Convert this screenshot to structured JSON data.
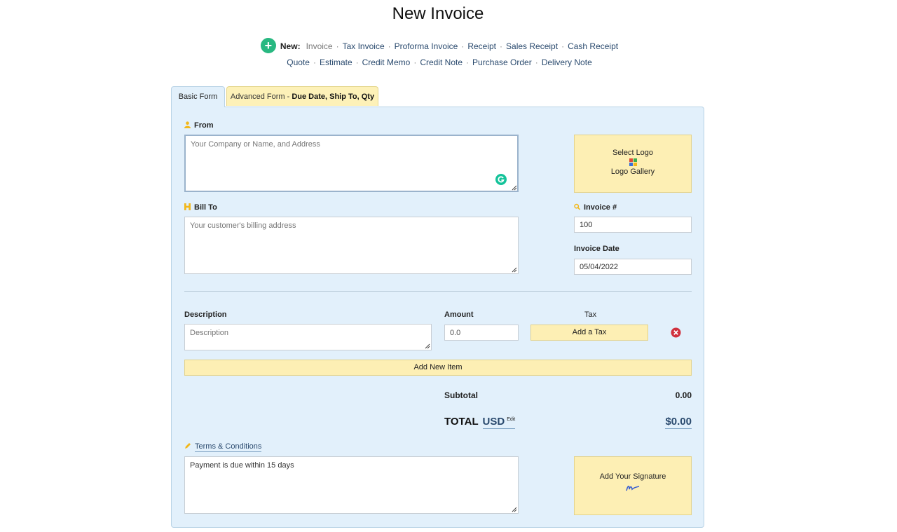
{
  "page": {
    "title": "New Invoice"
  },
  "nav": {
    "new_label": "New:",
    "row1": [
      "Invoice",
      "Tax Invoice",
      "Proforma Invoice",
      "Receipt",
      "Sales Receipt",
      "Cash Receipt"
    ],
    "row2": [
      "Quote",
      "Estimate",
      "Credit Memo",
      "Credit Note",
      "Purchase Order",
      "Delivery Note"
    ],
    "sep": "·"
  },
  "tabs": {
    "basic": "Basic Form",
    "advanced_prefix": "Advanced Form - ",
    "advanced_bold": "Due Date, Ship To, Qty"
  },
  "from": {
    "label": "From",
    "placeholder": "Your Company or Name, and Address"
  },
  "bill_to": {
    "label": "Bill To",
    "placeholder": "Your customer's billing address"
  },
  "logo": {
    "select": "Select Logo",
    "gallery": "Logo Gallery"
  },
  "invoice_number": {
    "label": "Invoice #",
    "value": "100"
  },
  "invoice_date": {
    "label": "Invoice Date",
    "value": "05/04/2022"
  },
  "items": {
    "description_header": "Description",
    "amount_header": "Amount",
    "tax_header": "Tax",
    "description_placeholder": "Description",
    "amount_value": "0.0",
    "add_tax": "Add a Tax",
    "add_item": "Add New Item"
  },
  "totals": {
    "subtotal_label": "Subtotal",
    "subtotal_value": "0.00",
    "total_label": "TOTAL",
    "currency": "USD",
    "edit": "Edit",
    "total_value": "$0.00"
  },
  "terms": {
    "label": "Terms & Conditions",
    "value": "Payment is due within 15 days"
  },
  "signature": {
    "label": "Add Your Signature"
  },
  "colors": {
    "accent_green": "#28b881",
    "panel_bg": "#e2f0fb",
    "yellow_btn": "#fdefb4",
    "delete_red": "#d0313d"
  }
}
